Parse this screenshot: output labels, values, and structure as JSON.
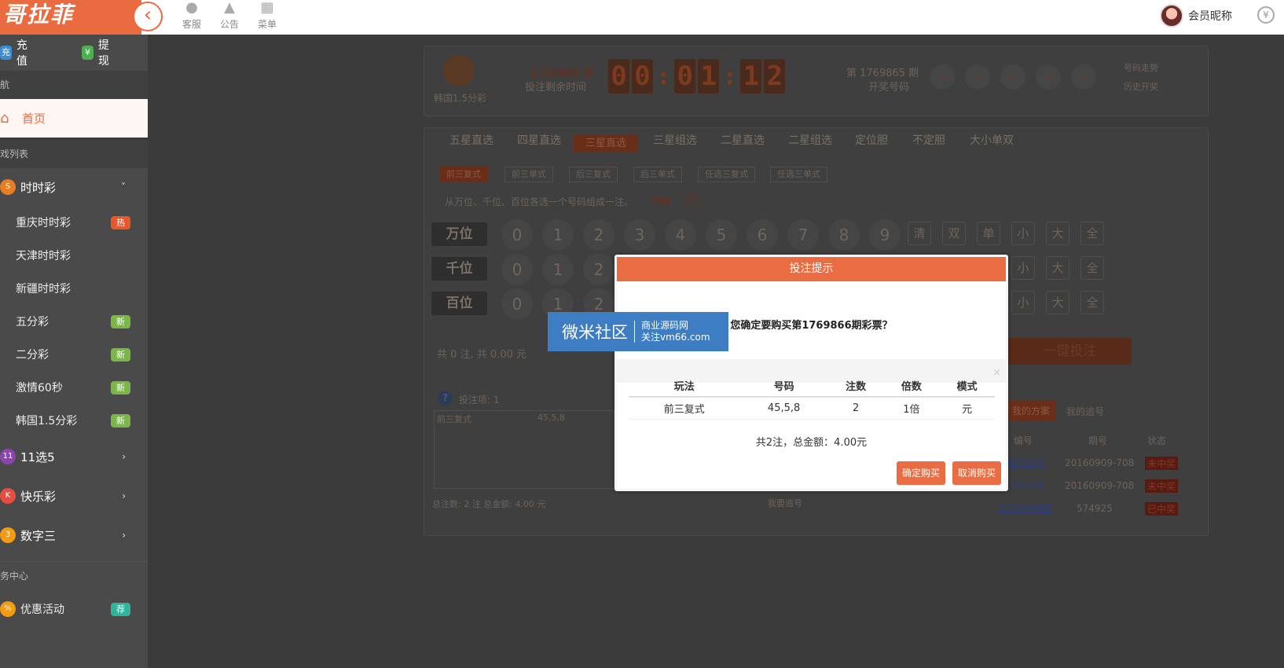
{
  "topbar": {
    "logo": "哥拉菲",
    "nav": [
      {
        "icon": "headset-icon",
        "label": "客服"
      },
      {
        "icon": "bell-icon",
        "label": "公告"
      },
      {
        "icon": "grid-icon",
        "label": "菜单"
      }
    ],
    "user": "会员昵称"
  },
  "sidebar": {
    "recharge": "充值",
    "recharge_icon": "充",
    "withdraw": "提现",
    "withdraw_icon": "¥",
    "section_nav": "航",
    "home": "首页",
    "section_games": "戏列表",
    "groups": [
      {
        "label": "时时彩",
        "items": [
          {
            "label": "重庆时时彩",
            "badge": "热",
            "badge_color": "#e8562a"
          },
          {
            "label": "天津时时彩",
            "badge": "",
            "badge_color": ""
          },
          {
            "label": "新疆时时彩",
            "badge": "",
            "badge_color": ""
          },
          {
            "label": "五分彩",
            "badge": "新",
            "badge_color": "#7ab648"
          },
          {
            "label": "二分彩",
            "badge": "新",
            "badge_color": "#7ab648"
          },
          {
            "label": "激情60秒",
            "badge": "新",
            "badge_color": "#7ab648"
          },
          {
            "label": "韩国1.5分彩",
            "badge": "新",
            "badge_color": "#7ab648"
          }
        ]
      },
      {
        "label": "11选5"
      },
      {
        "label": "快乐彩"
      },
      {
        "label": "数字三"
      }
    ],
    "section_center": "务中心",
    "promo": "优惠活动",
    "promo_badge": "荐"
  },
  "game": {
    "name": "韩国1.5分彩",
    "period": "1769866 期",
    "remaining": "投注剩余时间",
    "digits": [
      "0",
      "0",
      "0",
      "1",
      "1",
      "2"
    ],
    "open_label_top": "第 1769865 期",
    "open_label": "开奖号码",
    "draws": [
      "-",
      "-",
      "-",
      "-",
      "-"
    ],
    "trend": "号码走势",
    "history": "历史开奖"
  },
  "tabs": [
    "五星直选",
    "四星直选",
    "三星直选",
    "三星组选",
    "二星直选",
    "二星组选",
    "定位胆",
    "不定胆",
    "大小单双"
  ],
  "subtabs": [
    "前三复式",
    "前三单式",
    "后三复式",
    "后三单式",
    "任选三复式",
    "任选三单式"
  ],
  "hint": "从万位、千位、百位各选一个号码组成一注。",
  "hint_link": "范例",
  "rows": [
    "万位",
    "千位",
    "百位"
  ],
  "balls": [
    "0",
    "1",
    "2",
    "3",
    "4",
    "5",
    "6",
    "7",
    "8",
    "9"
  ],
  "opts": [
    "清",
    "双",
    "单",
    "小",
    "大",
    "全"
  ],
  "summary": {
    "text": "共 0 注, 共 0.00 元",
    "total": "总注数: 2 注  总金额: 4.00 元",
    "bet_item": "投注项: 1",
    "bet_line_type": "前三复式",
    "bet_line_num": "45,5,8",
    "one_click": "一键投注",
    "chase": "我要追号"
  },
  "records": {
    "tabs": [
      "我的方案",
      "我的追号"
    ],
    "headers": [
      "编号",
      "期号",
      "状态"
    ],
    "rows": [
      [
        "...43718JF",
        "20160909-708",
        "未中奖"
      ],
      [
        "...1053RK",
        "20160909-708",
        "未中奖"
      ],
      [
        "2093WMBE",
        "574925",
        "已中奖"
      ]
    ]
  },
  "modal": {
    "title": "投注提示",
    "question": "您确定要购买第1769866期彩票？",
    "headers": [
      "玩法",
      "号码",
      "注数",
      "倍数",
      "模式"
    ],
    "row": [
      "前三复式",
      "45,5,8",
      "2",
      "1倍",
      "元"
    ],
    "total": "共2注，总金额：4.00元",
    "confirm": "确定购买",
    "cancel": "取消购买",
    "close": "×"
  },
  "watermark": {
    "big": "微米社区",
    "line1": "商业源码网",
    "line2": "关注vm66.com"
  }
}
